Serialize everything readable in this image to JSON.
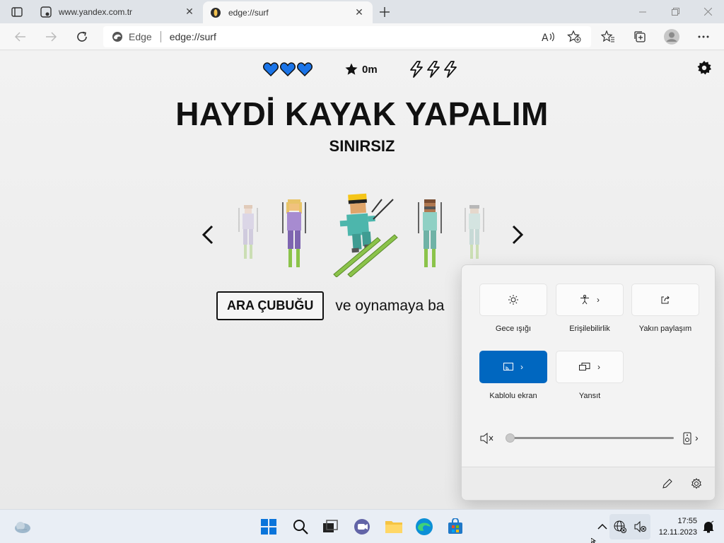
{
  "browser": {
    "tabs": [
      {
        "title": "www.yandex.com.tr",
        "icon": "yandex-favicon"
      },
      {
        "title": "edge://surf",
        "icon": "surf-favicon",
        "active": true
      }
    ],
    "address": {
      "chip": "Edge",
      "url": "edge://surf"
    }
  },
  "game": {
    "title": "HAYDİ KAYAK YAPALIM",
    "subtitle": "SINIRSIZ",
    "hud": {
      "lives": 3,
      "distance": "0m",
      "boosts": 3
    },
    "hint_key": "ARA ÇUBUĞU",
    "hint_text": "ve oynamaya ba",
    "colors": {
      "heart": "#1a74e8",
      "outline": "#111111"
    }
  },
  "quick_settings": {
    "tiles": [
      {
        "label": "Gece ışığı",
        "icon": "brightness-icon",
        "chevron": false,
        "active": false
      },
      {
        "label": "Erişilebilirlik",
        "icon": "accessibility-icon",
        "chevron": true,
        "active": false
      },
      {
        "label": "Yakın paylaşım",
        "icon": "share-icon",
        "chevron": false,
        "active": false
      },
      {
        "label": "Kablolu ekran",
        "icon": "cast-icon",
        "chevron": true,
        "active": true
      },
      {
        "label": "Yansıt",
        "icon": "project-icon",
        "chevron": true,
        "active": false
      }
    ],
    "volume": 0,
    "accent": "#0067c0"
  },
  "taskbar": {
    "time": "17:55",
    "date": "12.11.2023"
  }
}
